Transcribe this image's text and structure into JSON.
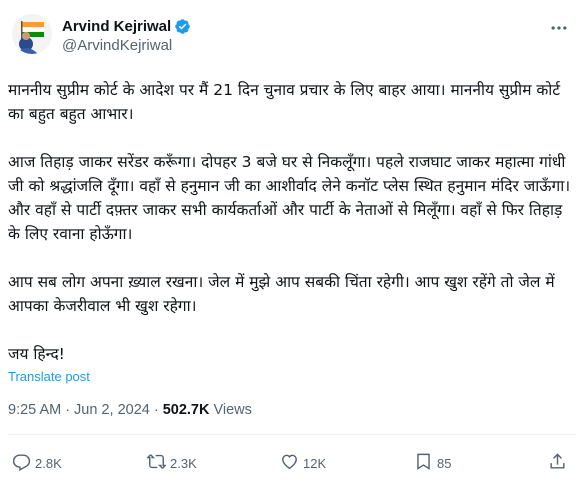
{
  "author": {
    "name": "Arvind Kejriwal",
    "handle": "@ArvindKejriwal",
    "verified_color": "#1d9bf0"
  },
  "tweet": {
    "paragraphs": [
      "माननीय सुप्रीम कोर्ट के आदेश पर मैं 21 दिन चुनाव प्रचार के लिए बाहर आया। माननीय सुप्रीम कोर्ट का बहुत बहुत आभार।",
      "आज तिहाड़ जाकर सरेंडर करूँगा। दोपहर 3 बजे घर से निकलूँगा। पहले राजघाट जाकर महात्मा गांधी जी को श्रद्धांजलि दूँगा। वहाँ से हनुमान जी का आशीर्वाद लेने कनॉट प्लेस स्थित हनुमान मंदिर जाऊँगा। और वहाँ से पार्टी दफ़्तर जाकर सभी कार्यकर्ताओं और पार्टी के नेताओं से मिलूँगा। वहाँ से फिर तिहाड़ के लिए रवाना होऊँगा।",
      "आप सब लोग अपना ख़्याल रखना। जेल में मुझे आप सबकी चिंता रहेगी। आप खुश रहेंगे तो जेल में आपका केजरीवाल भी खुश रहेगा।",
      "जय हिन्द!"
    ],
    "translate_label": "Translate post"
  },
  "meta": {
    "time": "9:25 AM",
    "separator": "·",
    "date": "Jun 2, 2024",
    "views_count": "502.7K",
    "views_label": "Views"
  },
  "actions": {
    "replies": "2.8K",
    "reposts": "2.3K",
    "likes": "12K",
    "bookmarks": "85"
  },
  "icons": {
    "more": "more-horizontal-icon",
    "verified": "verified-badge-icon",
    "reply": "reply-icon",
    "repost": "repost-icon",
    "like": "heart-icon",
    "bookmark": "bookmark-icon",
    "share": "share-icon"
  },
  "colors": {
    "text": "#0f1419",
    "secondary": "#536471",
    "link": "#1d9bf0",
    "divider": "#eff3f4"
  }
}
